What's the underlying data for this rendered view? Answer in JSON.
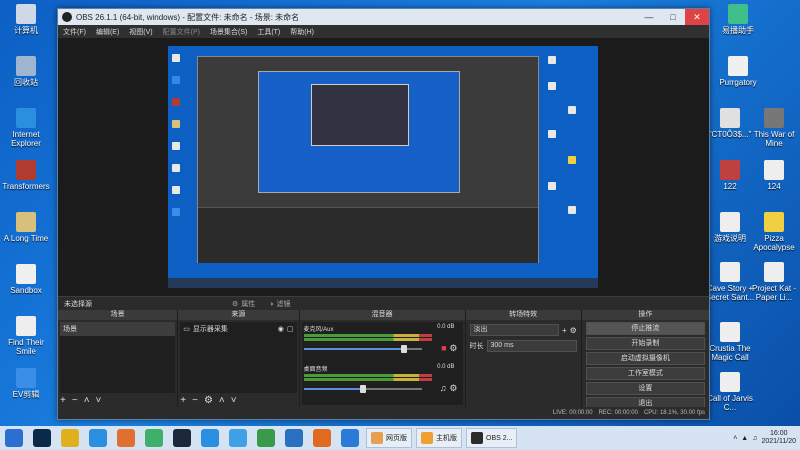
{
  "desktop": {
    "left_icons": [
      {
        "label": "计算机",
        "color": "#cfd8e6"
      },
      {
        "label": "回收站",
        "color": "#9fb4cf"
      },
      {
        "label": "Internet Explorer",
        "color": "#2b8fe0"
      },
      {
        "label": "Transformers",
        "color": "#b03b2f"
      },
      {
        "label": "A Long Time",
        "color": "#d8c07a"
      },
      {
        "label": "Sandbox",
        "color": "#f0f0f0"
      },
      {
        "label": "Find Their Smile",
        "color": "#eeeeee"
      },
      {
        "label": "EV剪辑",
        "color": "#3a8ee8"
      }
    ],
    "right_icons": [
      {
        "label": "易播助手",
        "color": "#3fbf8a"
      },
      {
        "label": "Purrgatory",
        "color": "#f0f0f0"
      },
      {
        "label": "\"CT0Ô3$...\"",
        "color": "#e0e0e0"
      },
      {
        "label": "This War of Mine",
        "color": "#777777"
      },
      {
        "label": "122",
        "color": "#c04040"
      },
      {
        "label": "124",
        "color": "#eeeeee"
      },
      {
        "label": "游戏说明",
        "color": "#eeeeee"
      },
      {
        "label": "Pizza Apocalypse",
        "color": "#f0d040"
      },
      {
        "label": "Cave Story + Secret Sant...",
        "color": "#eeeeee"
      },
      {
        "label": "Project Kat - Paper Li...",
        "color": "#eeeeee"
      },
      {
        "label": "Crustia The Magic Call",
        "color": "#eeeeee"
      },
      {
        "label": "Call of Jarvis C...",
        "color": "#eeeeee"
      }
    ]
  },
  "obs": {
    "title": "OBS 26.1.1 (64-bit, windows) - 配置文件: 未命名 - 场景: 未命名",
    "menu": [
      "文件(F)",
      "编辑(E)",
      "视图(V)",
      "配置文件(P)",
      "场景集合(S)",
      "工具(T)",
      "帮助(H)"
    ],
    "status_label": "未选择源",
    "props_label": "属性",
    "filters_label": "滤镜",
    "panels": {
      "scenes_title": "场景",
      "scenes": [
        "场景"
      ],
      "sources_title": "来源",
      "sources": [
        "显示器采集"
      ],
      "mixer_title": "混音器",
      "mixer": [
        {
          "name": "麦克风/Aux",
          "db": "0.0 dB",
          "level": 0.85
        },
        {
          "name": "桌面音频",
          "db": "0.0 dB",
          "level": 0.5
        }
      ],
      "transitions_title": "转场特效",
      "transition": "淡出",
      "duration_label": "时长",
      "duration_value": "300 ms",
      "controls_title": "操作",
      "controls": [
        "停止推流",
        "开始录制",
        "启动虚拟摄像机",
        "工作室模式",
        "设置",
        "退出"
      ]
    },
    "statusbar": [
      "LIVE: 00:00:00",
      "REC: 00:00:00",
      "CPU: 18.1%, 30.00 fps"
    ]
  },
  "taskbar": {
    "pinned": [
      {
        "name": "start-icon",
        "color": "#2b6fd0"
      },
      {
        "name": "photoshop-icon",
        "color": "#0b2a4a"
      },
      {
        "name": "chrome-icon",
        "color": "#e0b020"
      },
      {
        "name": "ie-icon",
        "color": "#2b8fe0"
      },
      {
        "name": "app-icon",
        "color": "#e07030"
      },
      {
        "name": "green-app-icon",
        "color": "#3fb06a"
      },
      {
        "name": "steam-icon",
        "color": "#1b2838"
      },
      {
        "name": "k-app-icon",
        "color": "#2a8fe0"
      },
      {
        "name": "cloud-icon",
        "color": "#3fa0e8"
      },
      {
        "name": "game-icon",
        "color": "#3a9a4a"
      },
      {
        "name": "grid-app-icon",
        "color": "#2a70c0"
      },
      {
        "name": "firefox-icon",
        "color": "#e06a20"
      },
      {
        "name": "bird-icon",
        "color": "#2a7ad8"
      }
    ],
    "tasks": [
      {
        "label": "网页版",
        "color": "#e8a050"
      },
      {
        "label": "主机版",
        "color": "#f0a030"
      },
      {
        "label": "OBS 2...",
        "color": "#2b2b2b"
      }
    ],
    "time": "16:00",
    "date": "2021/11/20"
  }
}
